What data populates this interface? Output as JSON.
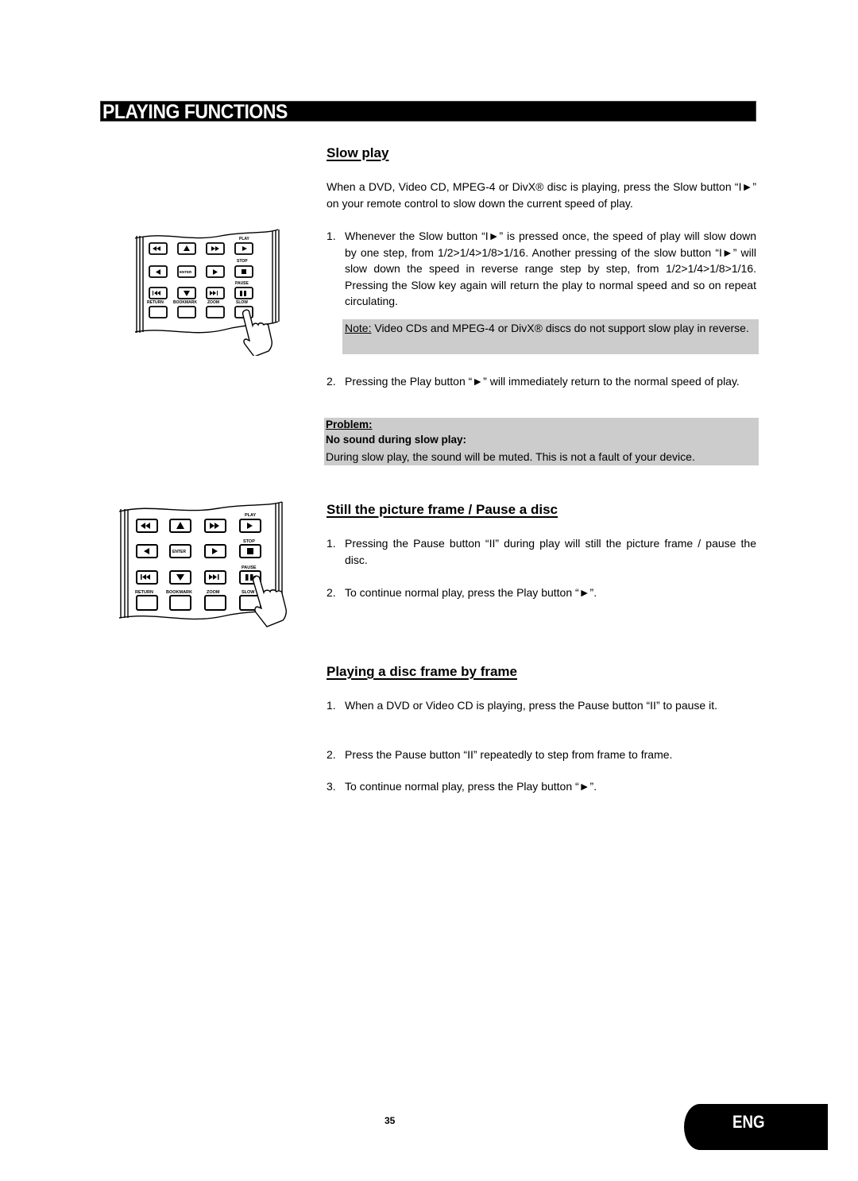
{
  "header": {
    "title": "PLAYING FUNCTIONS"
  },
  "remote": {
    "labels": {
      "play": "PLAY",
      "stop": "STOP",
      "pause": "PAUSE",
      "return": "RETURN",
      "bookmark": "BOOKMARK",
      "zoom": "ZOOM",
      "slow": "SLOW",
      "enter": "ENTER"
    }
  },
  "slow_play": {
    "heading": "Slow play",
    "intro": "When a DVD, Video CD, MPEG-4 or DivX® disc is playing, press the Slow button “I►” on your remote control to slow down the current speed of play.",
    "items": [
      {
        "num": "1.",
        "text": "Whenever the Slow button “I►” is pressed once, the speed of play will slow down by one step, from 1/2>1/4>1/8>1/16. Another pressing of the slow button “I►” will slow down the speed in reverse range step by step, from 1/2>1/4>1/8>1/16. Pressing the Slow key again will return the play to normal speed and so on repeat circulating."
      },
      {
        "num": "2.",
        "text": "Pressing the  Play button “►” will immediately return to the normal speed of play."
      }
    ],
    "note": {
      "label": "Note:",
      "text": " Video CDs and MPEG-4 or DivX® discs do not support slow play in reverse."
    },
    "problem": {
      "label": "Problem:",
      "title": "No sound during slow play:",
      "text": "During slow play, the sound will be muted. This is not a fault of your device."
    }
  },
  "still_frame": {
    "heading": "Still the picture frame / Pause a disc",
    "items": [
      {
        "num": "1.",
        "text": "Pressing the Pause button “II” during play will still the picture frame / pause the disc."
      },
      {
        "num": "2.",
        "text": "To continue normal play, press the Play button “►”."
      }
    ]
  },
  "frame_by_frame": {
    "heading": "Playing a disc frame by frame",
    "items": [
      {
        "num": "1.",
        "text": "When a DVD or Video CD is playing, press the Pause button “II” to pause it."
      },
      {
        "num": "2.",
        "text": "Press the Pause button “II” repeatedly to step from frame to frame."
      },
      {
        "num": "3.",
        "text": "To continue normal play, press the Play button “►”."
      }
    ]
  },
  "footer": {
    "page_number": "35",
    "language_tab": "ENG"
  }
}
